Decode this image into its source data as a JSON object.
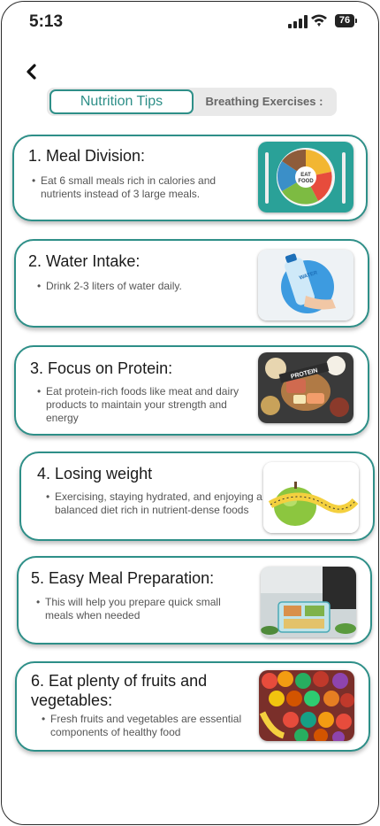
{
  "status_bar": {
    "time": "5:13",
    "battery": "76"
  },
  "tabs": {
    "active": "Nutrition Tips",
    "inactive": "Breathing Exercises :"
  },
  "cards": [
    {
      "title": "1. Meal Division:",
      "text": "Eat 6 small meals rich in calories and nutrients instead of 3 large meals.",
      "image": "healthy-plate-image",
      "image_label": "EAT FOOD"
    },
    {
      "title": "2. Water Intake:",
      "text": "Drink 2-3 liters of water daily.",
      "image": "water-bottle-image",
      "image_label": "WATER"
    },
    {
      "title": "3. Focus on Protein:",
      "text": "Eat protein-rich foods like meat and dairy products to maintain your strength and energy",
      "image": "protein-foods-image",
      "image_label": "PROTEIN"
    },
    {
      "title": "4. Losing weight",
      "text": "Exercising, staying hydrated, and enjoying a balanced diet rich in nutrient-dense foods",
      "image": "apple-measuring-tape-image"
    },
    {
      "title": "5. Easy Meal Preparation:",
      "text": "This will help you prepare quick small meals when needed",
      "image": "meal-prep-image"
    },
    {
      "title": "6. Eat plenty of fruits and vegetables:",
      "text": "Fresh fruits and vegetables are essential components of healthy food",
      "image": "fruits-vegetables-image"
    }
  ]
}
